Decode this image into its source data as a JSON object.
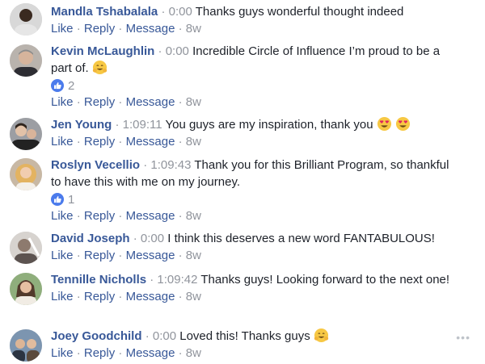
{
  "comments": [
    {
      "author": "Mandla Tshabalala",
      "timestamp": "0:00",
      "text": "Thanks guys wonderful thought indeed",
      "emojis": [],
      "reaction_count": null,
      "actions": {
        "like": "Like",
        "reply": "Reply",
        "message": "Message",
        "age": "8w"
      }
    },
    {
      "author": "Kevin McLaughlin",
      "timestamp": "0:00",
      "text": "Incredible Circle of Influence I’m proud to be a part of.",
      "emojis": [
        "hugging-face"
      ],
      "reaction_count": "2",
      "actions": {
        "like": "Like",
        "reply": "Reply",
        "message": "Message",
        "age": "8w"
      }
    },
    {
      "author": "Jen Young",
      "timestamp": "1:09:11",
      "text": "You guys are my inspiration, thank you",
      "emojis": [
        "heart-eyes",
        "heart-eyes"
      ],
      "reaction_count": null,
      "actions": {
        "like": "Like",
        "reply": "Reply",
        "message": "Message",
        "age": "8w"
      }
    },
    {
      "author": "Roslyn Vecellio",
      "timestamp": "1:09:43",
      "text": "Thank you for this Brilliant Program, so thankful to have this with me on my journey.",
      "emojis": [],
      "reaction_count": "1",
      "actions": {
        "like": "Like",
        "reply": "Reply",
        "message": "Message",
        "age": "8w"
      }
    },
    {
      "author": "David Joseph",
      "timestamp": "0:00",
      "text": "I think this deserves a new word FANTABULOUS!",
      "emojis": [],
      "reaction_count": null,
      "actions": {
        "like": "Like",
        "reply": "Reply",
        "message": "Message",
        "age": "8w"
      }
    },
    {
      "author": "Tennille Nicholls",
      "timestamp": "1:09:42",
      "text": "Thanks guys! Looking forward to the next one!",
      "emojis": [],
      "reaction_count": null,
      "actions": {
        "like": "Like",
        "reply": "Reply",
        "message": "Message",
        "age": "8w"
      }
    },
    {
      "author": "Joey Goodchild",
      "timestamp": "0:00",
      "text": "Loved this! Thanks guys",
      "emojis": [
        "hugging-face"
      ],
      "reaction_count": null,
      "actions": {
        "like": "Like",
        "reply": "Reply",
        "message": "Message",
        "age": "8w"
      }
    }
  ],
  "separator": "·",
  "reaction_icon": "like-icon",
  "more_options_icon": "more-options-icon",
  "colors": {
    "name": "#385898",
    "text": "#1d2129",
    "meta": "#90949c",
    "like_badge": "#4b7bec"
  }
}
